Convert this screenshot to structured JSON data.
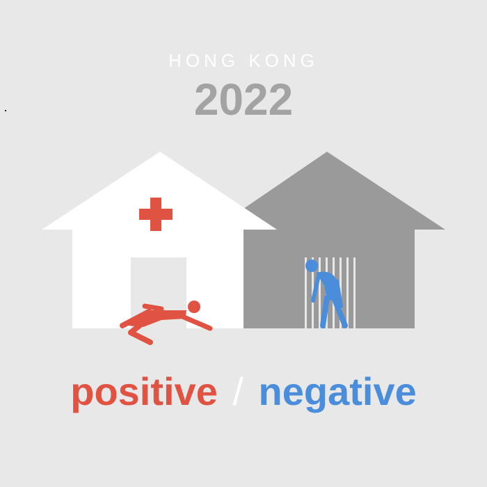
{
  "header": {
    "city": "HONG KONG",
    "year": "2022"
  },
  "caption": {
    "positive": "positive",
    "separator": "/",
    "negative": "negative"
  },
  "colors": {
    "background": "#e8e8e8",
    "hospital": "#ffffff",
    "quarantine": "#9a9a9a",
    "positive": "#e05242",
    "negative": "#4a8ddb",
    "year": "#a3a3a3"
  },
  "icons": [
    "red-cross-icon",
    "fallen-person-icon",
    "caged-person-icon"
  ]
}
